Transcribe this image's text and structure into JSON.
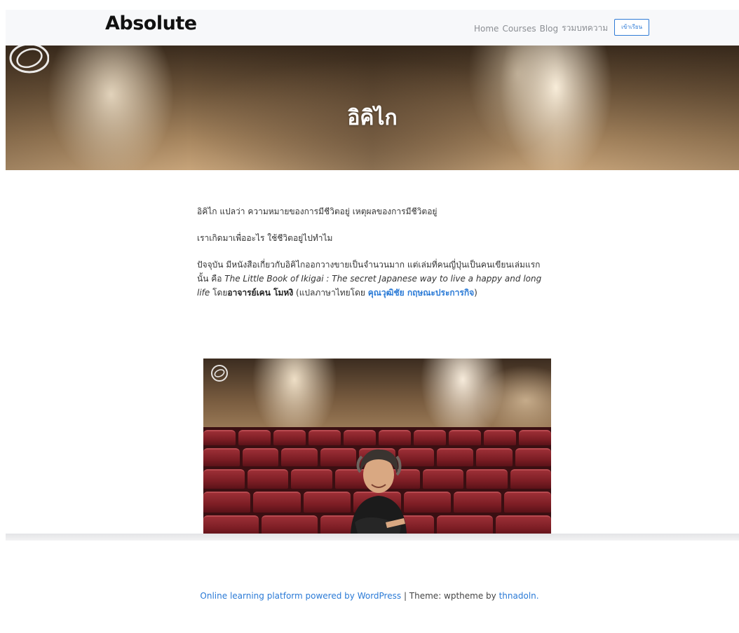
{
  "nav": {
    "brand": "Absolute",
    "links": [
      "Home",
      "Courses",
      "Blog",
      "รวมบทความ"
    ],
    "cta": "เข้าเรียน"
  },
  "hero": {
    "title": "อิคิไก"
  },
  "article": {
    "p1": "อิคิไก แปลว่า ความหมายของการมีชีวิตอยู่ เหตุผลของการมีชีวิตอยู่",
    "p2": "เราเกิดมาเพื่ออะไร ใช้ชีวิตอยู่ไปทำไม",
    "p3_prefix": "ปัจจุบัน มีหนังสือเกี่ยวกับอิคิไกออกวางขายเป็นจำนวนมาก แต่เล่มที่คนญี่ปุ่นเป็นคนเขียนเล่มแรกนั้น คือ ",
    "p3_book": "The Little Book of Ikigai : The secret Japanese way to live a happy and long life",
    "p3_by": " โดย",
    "p3_author": "อาจารย์เคน โมหงิ",
    "p3_translator_prefix": " (แปลภาษาไทยโดย ",
    "p3_translator": "คุณวุฒิชัย กฤษณะประการกิจ",
    "p3_suffix": ")"
  },
  "footer": {
    "platform_link": "Online learning platform powered by WordPress",
    "separator": " | Theme: wptheme by ",
    "author_link": "thnadoln."
  },
  "colors": {
    "accent": "#2a7ad6",
    "nav_bg": "#f7f8fa",
    "seat": "#8c252c"
  }
}
